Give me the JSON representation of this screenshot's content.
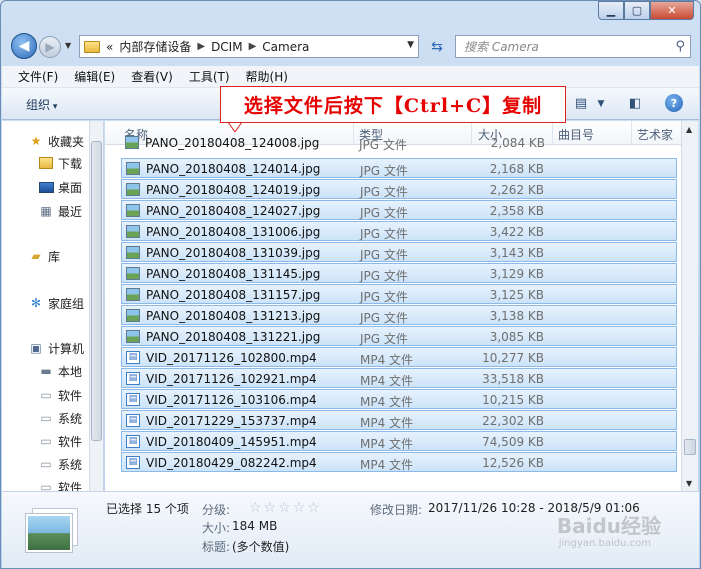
{
  "address": {
    "crumbs": [
      "«",
      "内部存储设备",
      "DCIM",
      "Camera"
    ],
    "search_placeholder": "搜索 Camera"
  },
  "menu": [
    "文件(F)",
    "编辑(E)",
    "查看(V)",
    "工具(T)",
    "帮助(H)"
  ],
  "toolbar": {
    "organize": "组织"
  },
  "annotation": "选择文件后按下【Ctrl+C】复制",
  "navpane": {
    "items": [
      {
        "label": "收藏夹",
        "icon": "star-icon"
      },
      {
        "label": "下载",
        "icon": "download-folder-icon"
      },
      {
        "label": "桌面",
        "icon": "desktop-icon"
      },
      {
        "label": "最近",
        "icon": "recent-places-icon"
      },
      {
        "label": "库",
        "icon": "library-icon"
      },
      {
        "label": "家庭组",
        "icon": "homegroup-icon"
      },
      {
        "label": "计算机",
        "icon": "computer-icon"
      },
      {
        "label": "本地",
        "icon": "local-disk-icon"
      },
      {
        "label": "软件",
        "icon": "drive-icon"
      },
      {
        "label": "系统",
        "icon": "drive-icon"
      },
      {
        "label": "软件",
        "icon": "drive-icon"
      },
      {
        "label": "系统",
        "icon": "drive-icon"
      },
      {
        "label": "软件",
        "icon": "drive-icon"
      }
    ]
  },
  "columns": {
    "name": "名称",
    "type": "类型",
    "size": "大小",
    "track": "曲目号",
    "artist": "艺术家"
  },
  "files": [
    {
      "name": "PANO_20180408_124008.jpg",
      "type": "JPG 文件",
      "size": "2,084 KB",
      "kind": "jpg",
      "selected": false
    },
    {
      "name": "PANO_20180408_124014.jpg",
      "type": "JPG 文件",
      "size": "2,168 KB",
      "kind": "jpg",
      "selected": true
    },
    {
      "name": "PANO_20180408_124019.jpg",
      "type": "JPG 文件",
      "size": "2,262 KB",
      "kind": "jpg",
      "selected": true
    },
    {
      "name": "PANO_20180408_124027.jpg",
      "type": "JPG 文件",
      "size": "2,358 KB",
      "kind": "jpg",
      "selected": true
    },
    {
      "name": "PANO_20180408_131006.jpg",
      "type": "JPG 文件",
      "size": "3,422 KB",
      "kind": "jpg",
      "selected": true
    },
    {
      "name": "PANO_20180408_131039.jpg",
      "type": "JPG 文件",
      "size": "3,143 KB",
      "kind": "jpg",
      "selected": true
    },
    {
      "name": "PANO_20180408_131145.jpg",
      "type": "JPG 文件",
      "size": "3,129 KB",
      "kind": "jpg",
      "selected": true
    },
    {
      "name": "PANO_20180408_131157.jpg",
      "type": "JPG 文件",
      "size": "3,125 KB",
      "kind": "jpg",
      "selected": true
    },
    {
      "name": "PANO_20180408_131213.jpg",
      "type": "JPG 文件",
      "size": "3,138 KB",
      "kind": "jpg",
      "selected": true
    },
    {
      "name": "PANO_20180408_131221.jpg",
      "type": "JPG 文件",
      "size": "3,085 KB",
      "kind": "jpg",
      "selected": true
    },
    {
      "name": "VID_20171126_102800.mp4",
      "type": "MP4 文件",
      "size": "10,277 KB",
      "kind": "mp4",
      "selected": true
    },
    {
      "name": "VID_20171126_102921.mp4",
      "type": "MP4 文件",
      "size": "33,518 KB",
      "kind": "mp4",
      "selected": true
    },
    {
      "name": "VID_20171126_103106.mp4",
      "type": "MP4 文件",
      "size": "10,215 KB",
      "kind": "mp4",
      "selected": true
    },
    {
      "name": "VID_20171229_153737.mp4",
      "type": "MP4 文件",
      "size": "22,302 KB",
      "kind": "mp4",
      "selected": true
    },
    {
      "name": "VID_20180409_145951.mp4",
      "type": "MP4 文件",
      "size": "74,509 KB",
      "kind": "mp4",
      "selected": true
    },
    {
      "name": "VID_20180429_082242.mp4",
      "type": "MP4 文件",
      "size": "12,526 KB",
      "kind": "mp4",
      "selected": true
    }
  ],
  "details": {
    "selected_count": "已选择 15 个项",
    "rating_label": "分级:",
    "size_label": "大小:",
    "size_value": "184 MB",
    "title_label": "标题:",
    "title_value": "(多个数值)",
    "modified_label": "修改日期:",
    "modified_value": "2017/11/26 10:28 - 2018/5/9 01:06"
  },
  "watermark": {
    "main": "Baidu经验",
    "sub": "jingyan.baidu.com"
  }
}
